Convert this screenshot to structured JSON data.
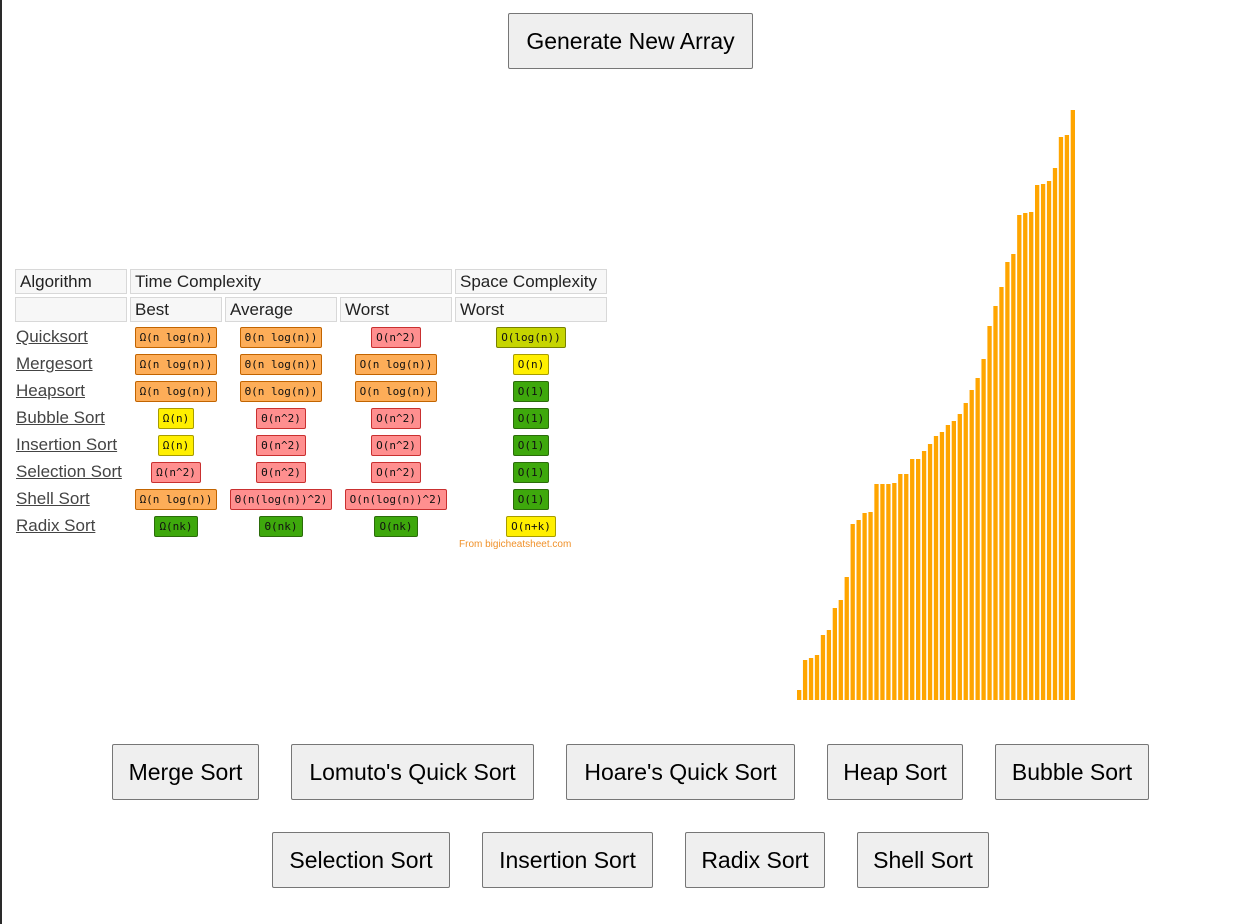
{
  "generate_button": "Generate New Array",
  "table": {
    "header_algorithm": "Algorithm",
    "header_time": "Time Complexity",
    "header_space": "Space Complexity",
    "sub_best": "Best",
    "sub_average": "Average",
    "sub_worst": "Worst",
    "sub_space_worst": "Worst",
    "rows": [
      {
        "name": "Quicksort",
        "best": "Ω(n log(n))",
        "best_color": "orange",
        "avg": "Θ(n log(n))",
        "avg_color": "orange",
        "worst": "O(n^2)",
        "worst_color": "red",
        "space": "O(log(n))",
        "space_color": "lime"
      },
      {
        "name": "Mergesort",
        "best": "Ω(n log(n))",
        "best_color": "orange",
        "avg": "Θ(n log(n))",
        "avg_color": "orange",
        "worst": "O(n log(n))",
        "worst_color": "orange",
        "space": "O(n)",
        "space_color": "yellow"
      },
      {
        "name": "Heapsort",
        "best": "Ω(n log(n))",
        "best_color": "orange",
        "avg": "Θ(n log(n))",
        "avg_color": "orange",
        "worst": "O(n log(n))",
        "worst_color": "orange",
        "space": "O(1)",
        "space_color": "green"
      },
      {
        "name": "Bubble Sort",
        "best": "Ω(n)",
        "best_color": "yellow",
        "avg": "Θ(n^2)",
        "avg_color": "red",
        "worst": "O(n^2)",
        "worst_color": "red",
        "space": "O(1)",
        "space_color": "green"
      },
      {
        "name": "Insertion Sort",
        "best": "Ω(n)",
        "best_color": "yellow",
        "avg": "Θ(n^2)",
        "avg_color": "red",
        "worst": "O(n^2)",
        "worst_color": "red",
        "space": "O(1)",
        "space_color": "green"
      },
      {
        "name": "Selection Sort",
        "best": "Ω(n^2)",
        "best_color": "red",
        "avg": "Θ(n^2)",
        "avg_color": "red",
        "worst": "O(n^2)",
        "worst_color": "red",
        "space": "O(1)",
        "space_color": "green"
      },
      {
        "name": "Shell Sort",
        "best": "Ω(n log(n))",
        "best_color": "orange",
        "avg": "Θ(n(log(n))^2)",
        "avg_color": "red",
        "worst": "O(n(log(n))^2)",
        "worst_color": "red",
        "space": "O(1)",
        "space_color": "green"
      },
      {
        "name": "Radix Sort",
        "best": "Ω(nk)",
        "best_color": "green",
        "avg": "Θ(nk)",
        "avg_color": "green",
        "worst": "O(nk)",
        "worst_color": "green",
        "space": "O(n+k)",
        "space_color": "yellow"
      }
    ],
    "credit": "From bigicheatsheet.com"
  },
  "chart_data": {
    "type": "bar",
    "bar_color": "#ffa500",
    "values": [
      10,
      40,
      42,
      45,
      65,
      70,
      92,
      100,
      123,
      176,
      180,
      187,
      188,
      216,
      216,
      216,
      217,
      226,
      226,
      241,
      241,
      249,
      256,
      264,
      268,
      275,
      279,
      286,
      297,
      310,
      322,
      341,
      374,
      394,
      413,
      438,
      446,
      485,
      487,
      488,
      515,
      516,
      519,
      532,
      563,
      565,
      590
    ]
  },
  "sort_buttons_row1": [
    "Merge Sort",
    "Lomuto's Quick Sort",
    "Hoare's Quick Sort",
    "Heap Sort",
    "Bubble Sort"
  ],
  "sort_buttons_row2": [
    "Selection Sort",
    "Insertion Sort",
    "Radix Sort",
    "Shell Sort"
  ]
}
